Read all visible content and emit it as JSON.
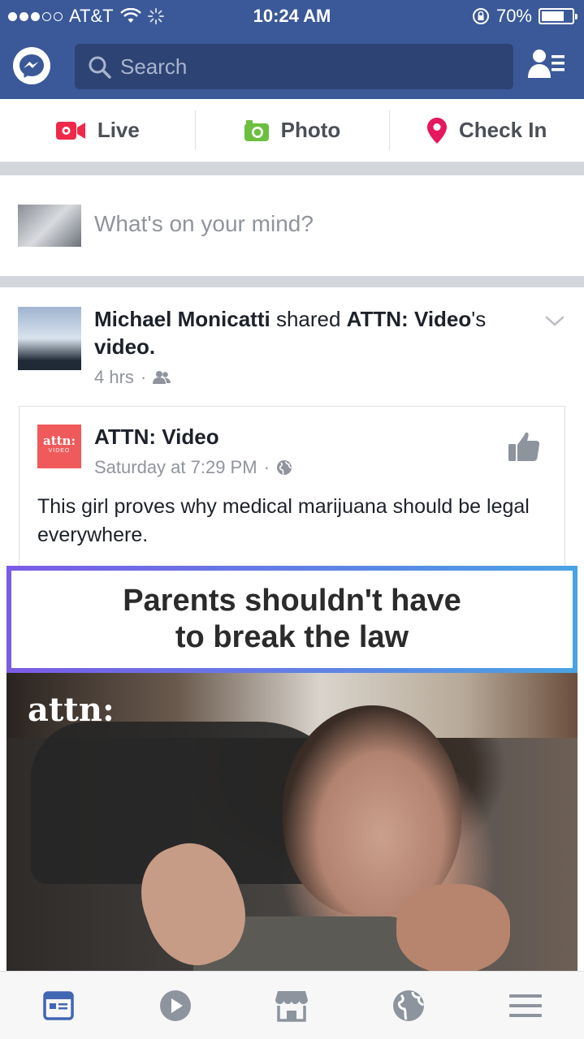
{
  "status_bar": {
    "carrier": "AT&T",
    "time": "10:24 AM",
    "battery": "70%",
    "battery_level": 0.7
  },
  "top_bar": {
    "search_placeholder": "Search",
    "icons": [
      "messenger-icon",
      "search-icon",
      "friend-requests-icon"
    ]
  },
  "composer": {
    "live_label": "Live",
    "photo_label": "Photo",
    "checkin_label": "Check In"
  },
  "status_prompt": "What's on your mind?",
  "post": {
    "author": "Michael Monicatti",
    "action": "shared",
    "shared_from": "ATTN: Video",
    "suffix": "'s",
    "object": "video.",
    "time": "4 hrs",
    "privacy_icon": "friends-icon",
    "shared": {
      "logo_text": "attn:",
      "logo_subtext": "VIDEO",
      "page_name": "ATTN: Video",
      "time": "Saturday at 7:29 PM",
      "privacy_icon": "globe-icon",
      "text": "This girl proves why medical marijuana should be legal everywhere.",
      "video_caption_line1": "Parents shouldn't have",
      "video_caption_line2": "to break the law",
      "video_watermark": "attn:"
    }
  },
  "tab_bar": {
    "tabs": [
      "news-feed-icon",
      "video-icon",
      "marketplace-icon",
      "notifications-globe-icon",
      "menu-icon"
    ],
    "active_color": "#4267b2",
    "inactive_color": "#8d949e"
  }
}
